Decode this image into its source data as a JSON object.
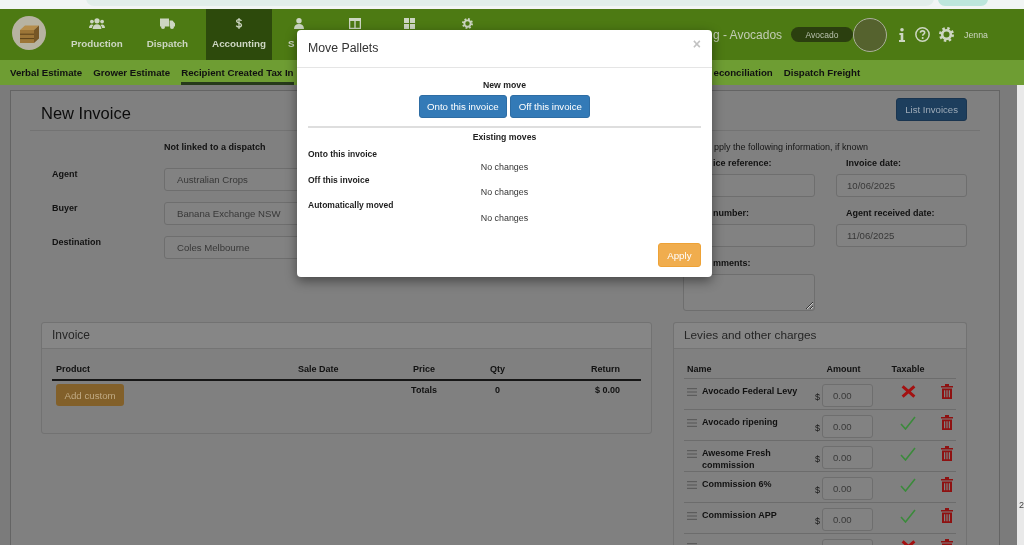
{
  "top_bar": {
    "nav": [
      {
        "label": "Production",
        "selected": false
      },
      {
        "label": "Dispatch",
        "selected": false
      },
      {
        "label": "Accounting",
        "selected": true
      },
      {
        "label": "S",
        "selected": false
      },
      {
        "selected": false
      },
      {
        "selected": false
      },
      {
        "selected": false
      }
    ],
    "title": "g - Avocados",
    "crop": "Avocado",
    "user": "Jenna"
  },
  "sub_nav": [
    {
      "label": "Verbal Estimate",
      "selected": false
    },
    {
      "label": "Grower Estimate",
      "selected": false
    },
    {
      "label": "Recipient Created Tax In",
      "selected": true
    },
    {
      "label": "econciliation",
      "selected": false
    },
    {
      "label": "Dispatch Freight",
      "selected": false
    }
  ],
  "page": {
    "title": "New Invoice",
    "list_button": "List Invoices",
    "dispatch_note": "Not linked to a dispatch",
    "fields": [
      {
        "label": "Agent",
        "value": "Australian Crops"
      },
      {
        "label": "Buyer",
        "value": "Banana Exchange NSW"
      },
      {
        "label": "Destination",
        "value": "Coles Melbourne"
      }
    ],
    "info_note": "pply the following information, if known",
    "info_fields": [
      {
        "label": "ice reference:",
        "kind": "input"
      },
      {
        "label": "Invoice date:",
        "kind": "input",
        "value": "10/06/2025"
      },
      {
        "label": "number:",
        "kind": "input"
      },
      {
        "label": "Agent received date:",
        "kind": "input",
        "value": "11/06/2025"
      },
      {
        "label": "mments:",
        "kind": "textarea"
      }
    ]
  },
  "invoice": {
    "title": "Invoice",
    "columns": [
      "Product",
      "Sale Date",
      "Price",
      "Qty",
      "Return"
    ],
    "add_button": "Add custom",
    "totals": {
      "label": "Totals",
      "qty": "0",
      "return": "$ 0.00"
    }
  },
  "levies": {
    "title": "Levies and other charges",
    "columns": [
      "Name",
      "Amount",
      "Taxable"
    ],
    "rows": [
      {
        "name": "Avocado Federal Levy",
        "currency": "$",
        "amount": "0.00",
        "taxable": false
      },
      {
        "name": "Avocado ripening",
        "currency": "$",
        "amount": "0.00",
        "taxable": true
      },
      {
        "name": "Awesome Fresh commission",
        "currency": "$",
        "amount": "0.00",
        "taxable": true
      },
      {
        "name": "Commission 6%",
        "currency": "$",
        "amount": "0.00",
        "taxable": true
      },
      {
        "name": "Commission APP",
        "currency": "$",
        "amount": "0.00",
        "taxable": true
      },
      {
        "taxable": false
      }
    ]
  },
  "dialog": {
    "title": "Move Pallets",
    "close": "×",
    "new_move": {
      "heading": "New move",
      "buttons": [
        "Onto this invoice",
        "Off this invoice"
      ]
    },
    "existing_moves": {
      "heading": "Existing moves",
      "groups": [
        {
          "label": "Onto this invoice",
          "status": "No changes"
        },
        {
          "label": "Off this invoice",
          "status": "No changes"
        },
        {
          "label": "Automatically moved",
          "status": "No changes"
        }
      ]
    },
    "apply": "Apply"
  },
  "edge_text": "2"
}
